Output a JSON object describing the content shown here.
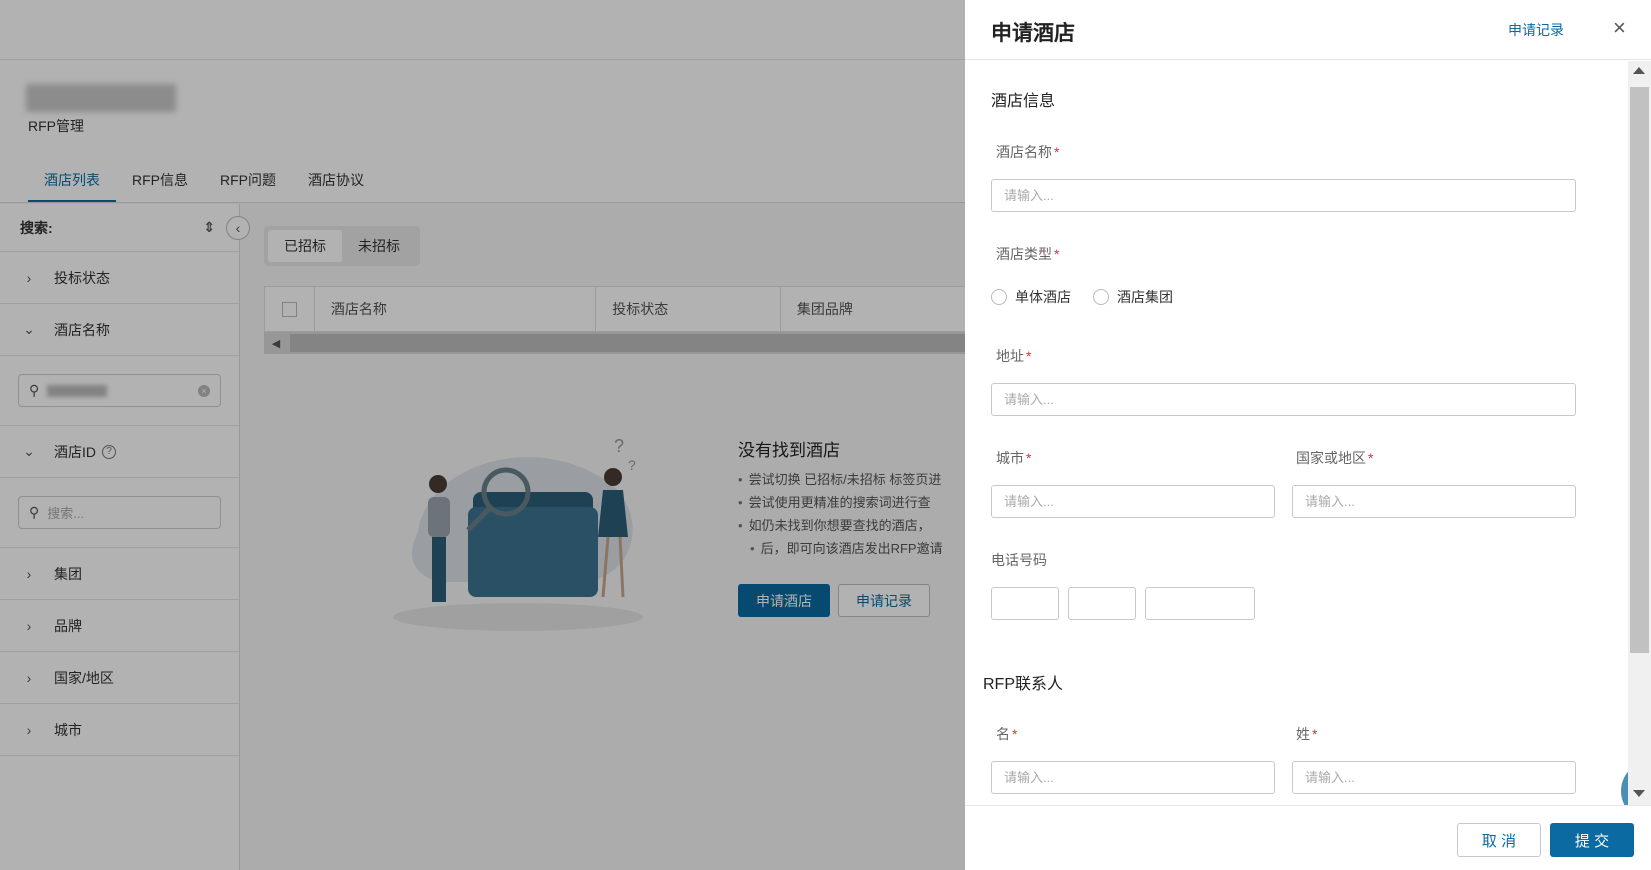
{
  "page": {
    "subtitle": "RFP管理",
    "tabs": [
      "酒店列表",
      "RFP信息",
      "RFP问题",
      "酒店协议"
    ],
    "active_tab": "酒店列表"
  },
  "sidebar": {
    "search_label": "搜索:",
    "filters": {
      "bid_status": "投标状态",
      "hotel_name": "酒店名称",
      "hotel_id": "酒店ID",
      "group": "集团",
      "brand": "品牌",
      "country": "国家/地区",
      "city": "城市"
    },
    "id_search_placeholder": "搜索..."
  },
  "content": {
    "segments": [
      "已招标",
      "未招标"
    ],
    "columns": [
      "酒店名称",
      "投标状态",
      "集团品牌"
    ],
    "empty": {
      "title": "没有找到酒店",
      "tips": [
        "尝试切换 已招标/未招标 标签页进",
        "尝试使用更精准的搜索词进行查",
        "如仍未找到你想要查找的酒店，",
        "后，即可向该酒店发出RFP邀请"
      ],
      "apply_button": "申请酒店",
      "records_button": "申请记录"
    }
  },
  "drawer": {
    "title": "申请酒店",
    "records_link": "申请记录",
    "close_glyph": "×",
    "hotel_section": "酒店信息",
    "fields": {
      "hotel_name": {
        "label": "酒店名称",
        "placeholder": "请输入..."
      },
      "hotel_type": {
        "label": "酒店类型",
        "options": [
          "单体酒店",
          "酒店集团"
        ]
      },
      "address": {
        "label": "地址",
        "placeholder": "请输入..."
      },
      "city": {
        "label": "城市",
        "placeholder": "请输入..."
      },
      "country": {
        "label": "国家或地区",
        "placeholder": "请输入..."
      },
      "phone": {
        "label": "电话号码"
      }
    },
    "contact_section": "RFP联系人",
    "contact_fields": {
      "first_name": {
        "label": "名",
        "placeholder": "请输入..."
      },
      "last_name": {
        "label": "姓",
        "placeholder": "请输入..."
      }
    },
    "required_mark": "*",
    "cancel_button": "取 消",
    "submit_button": "提 交"
  },
  "colors": {
    "primary": "#0b6aa2",
    "required": "#e0303a"
  }
}
